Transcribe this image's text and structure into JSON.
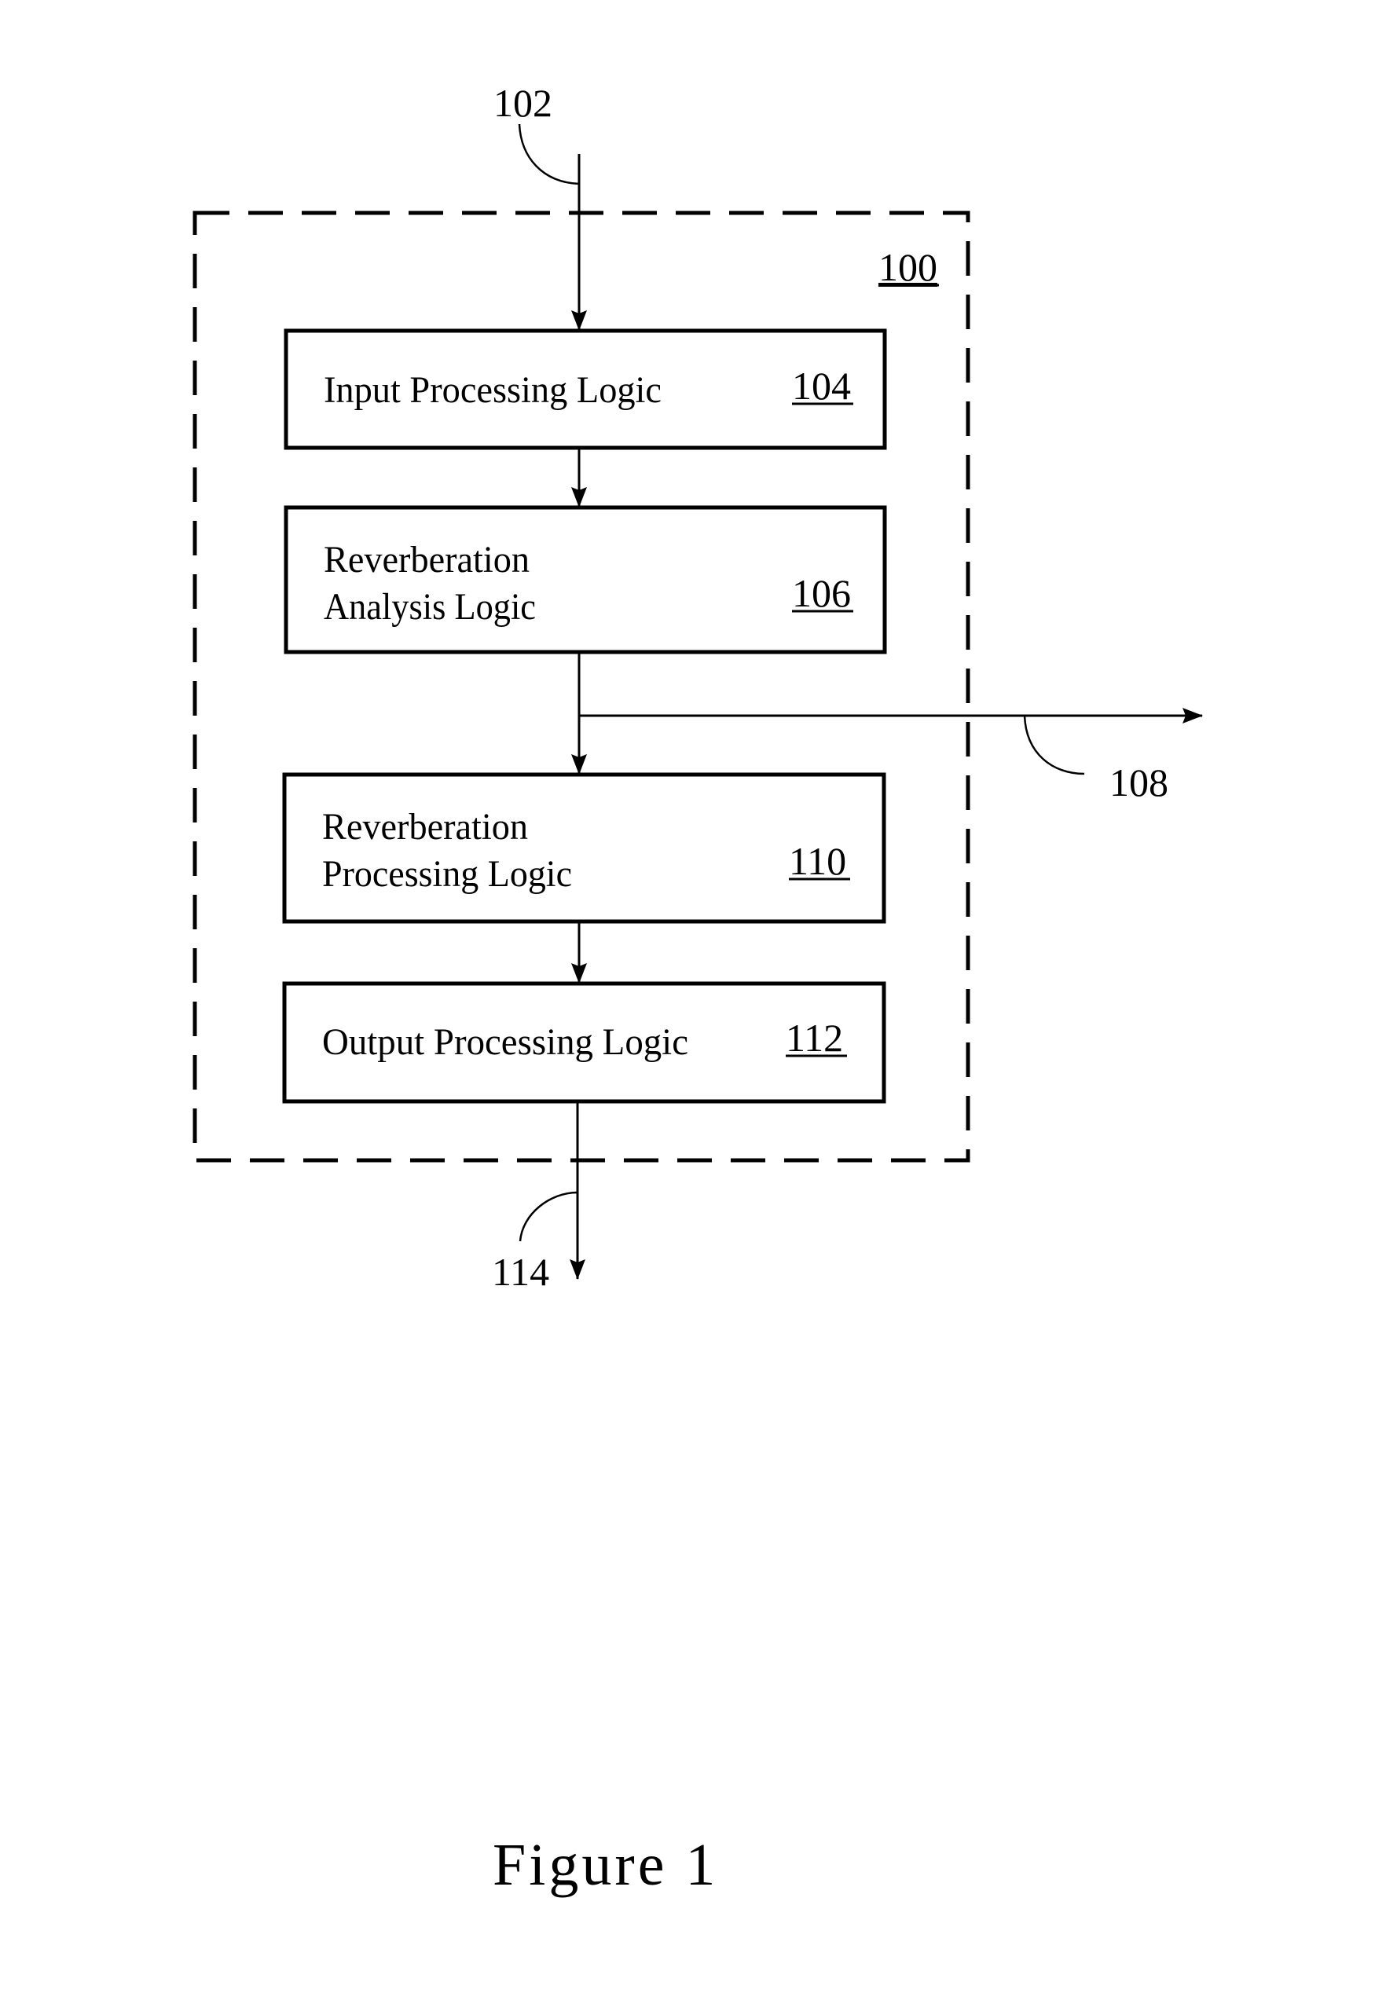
{
  "system": {
    "ref": "100"
  },
  "input_signal": {
    "ref": "102"
  },
  "blocks": [
    {
      "id": "input-processing",
      "lines": [
        "Input Processing Logic"
      ],
      "ref": "104"
    },
    {
      "id": "reverberation-analysis",
      "lines": [
        "Reverberation",
        "Analysis Logic"
      ],
      "ref": "106"
    },
    {
      "id": "reverberation-processing",
      "lines": [
        "Reverberation",
        "Processing Logic"
      ],
      "ref": "110"
    },
    {
      "id": "output-processing",
      "lines": [
        "Output Processing Logic"
      ],
      "ref": "112"
    }
  ],
  "analysis_output": {
    "ref": "108"
  },
  "output_signal": {
    "ref": "114"
  },
  "caption": "Figure 1"
}
